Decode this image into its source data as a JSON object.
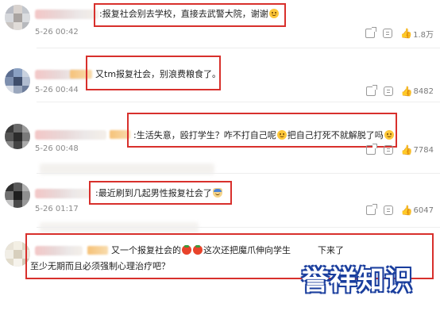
{
  "comments": [
    {
      "text_before": ":报复社会别去学校，直接去武警大院，谢谢",
      "emoji": "smile",
      "time": "5-26 00:42",
      "likes": "1.8万"
    },
    {
      "text_before": "又tm报复社会，别浪费粮食了。",
      "time": "5-26 00:44",
      "likes": "8482"
    },
    {
      "text_part1": ":生活失意，殴打学生？咋不打自己呢",
      "text_part2": "把自己打死不就解脱了吗",
      "time": "5-26 00:48",
      "likes": "7784"
    },
    {
      "text_before": ":最近刷到几起男性报复社会了",
      "time": "5-26 01:17",
      "likes": "6047"
    },
    {
      "line1_part1": "又一个报复社会的",
      "line1_part2": "这次还把魔爪伸向学生",
      "line1_part3": "下来了",
      "line2": "至少无期而且必须强制心理治疗吧？"
    }
  ],
  "watermark": "誉祥知识",
  "icons": [
    "share-icon",
    "comment-icon",
    "like-icon",
    "smile-emoji",
    "tomato-emoji",
    "hat-emoji"
  ]
}
